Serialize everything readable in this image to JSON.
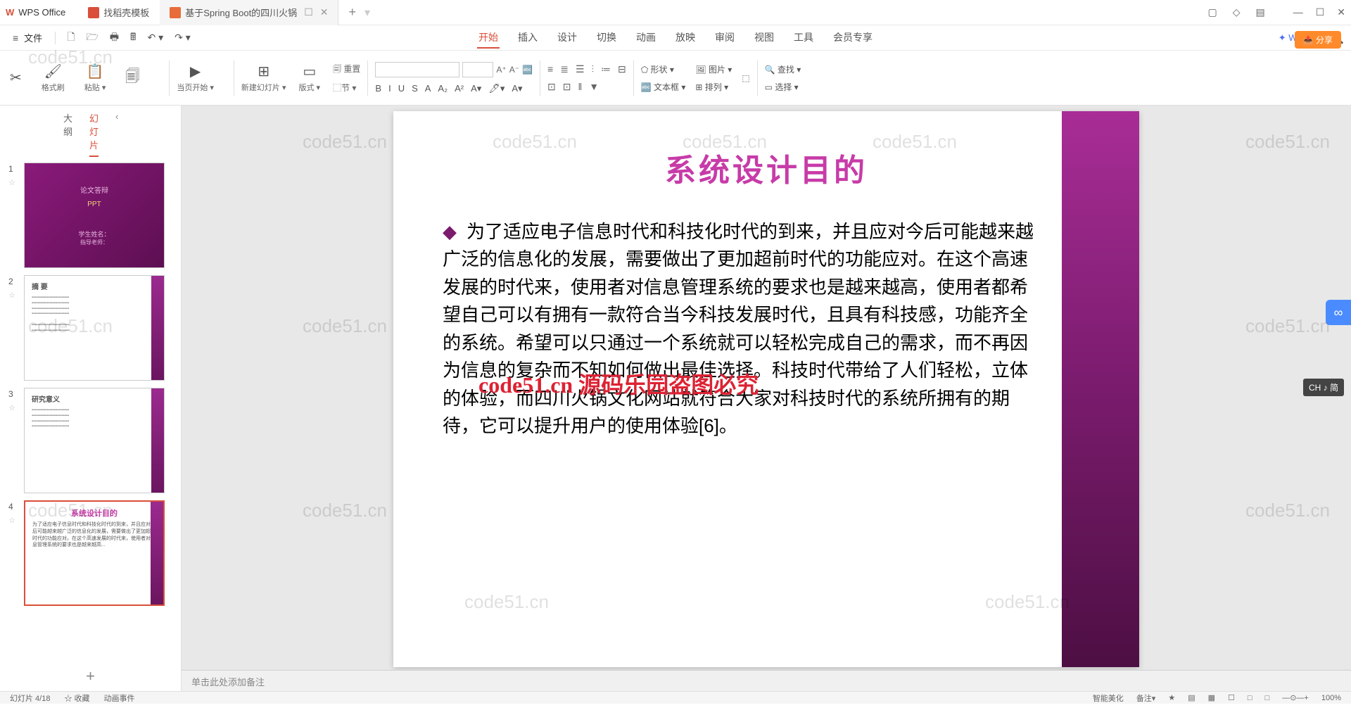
{
  "app": {
    "logo": "W",
    "name": "WPS Office"
  },
  "tabs": [
    {
      "icon_bg": "#d94f3a",
      "label": "找稻壳模板"
    },
    {
      "icon_bg": "#e86b3a",
      "label": "基于Spring Boot的四川火锅",
      "active": true
    }
  ],
  "win_icons": [
    "▢",
    "◇",
    "▤",
    "—",
    "☐",
    "✕"
  ],
  "qat": {
    "menu": "≡",
    "file": "文件",
    "icons": [
      "🗋",
      "🗁",
      "🖶",
      "🖩",
      "↶ ▾",
      "↷ ▾"
    ]
  },
  "ribbon": {
    "tabs": [
      "开始",
      "插入",
      "设计",
      "切换",
      "动画",
      "放映",
      "审阅",
      "视图",
      "工具",
      "会员专享"
    ],
    "active": 0,
    "ai": "WPS AI"
  },
  "tools": {
    "g1": [
      {
        "ico": "✂",
        "lbl": ""
      },
      {
        "ico": "🖌",
        "lbl": "格式刷"
      },
      {
        "ico": "📋",
        "lbl": "粘贴 ▾"
      },
      {
        "ico": "🗐",
        "lbl": ""
      }
    ],
    "g2": [
      {
        "ico": "▶",
        "lbl": "当页开始 ▾"
      }
    ],
    "g3": [
      {
        "ico": "⊞",
        "lbl": "新建幻灯片 ▾"
      },
      {
        "ico": "▭",
        "lbl": "版式 ▾"
      },
      {
        "ico": "🗐 重置",
        "lbl": "⬚节 ▾"
      }
    ],
    "font": [
      "B",
      "I",
      "U",
      "S",
      "A",
      "A₂",
      "A²",
      "A▾",
      "🖊▾",
      "A▾"
    ],
    "fsize": [
      "A⁺",
      "A⁻",
      "🔤"
    ],
    "para": [
      "≡",
      "≣",
      "☰",
      "⫶",
      "≔",
      "⊟",
      "⊡",
      "⊡",
      "‖",
      "▼"
    ],
    "g4": [
      {
        "ico": "⬠ 形状 ▾"
      },
      {
        "ico": "🔤 文本框 ▾"
      },
      {
        "ico": "⊞ 排列 ▾"
      }
    ],
    "g5": [
      {
        "ico": "🖼 图片 ▾"
      },
      {
        "ico": "⬚"
      }
    ],
    "g6": [
      {
        "ico": "🔍 查找 ▾"
      },
      {
        "ico": "▭ 选择 ▾"
      }
    ]
  },
  "sidebar": {
    "tabs": [
      "大纲",
      "幻灯片"
    ],
    "active": 1,
    "slides": [
      {
        "n": "1",
        "type": "title",
        "line1": "论文答辩",
        "line2": "学生姓名：",
        "line3": "指导老师："
      },
      {
        "n": "2",
        "type": "text",
        "title": "摘 要"
      },
      {
        "n": "3",
        "type": "text",
        "title": "研究意义"
      },
      {
        "n": "4",
        "type": "current",
        "title": "系统设计目的"
      }
    ]
  },
  "slide": {
    "title": "系统设计目的",
    "body": "为了适应电子信息时代和科技化时代的到来，并且应对今后可能越来越广泛的信息化的发展，需要做出了更加超前时代的功能应对。在这个高速发展的时代来，使用者对信息管理系统的要求也是越来越高，使用者都希望自己可以有拥有一款符合当今科技发展时代，且具有科技感，功能齐全的系统。希望可以只通过一个系统就可以轻松完成自己的需求，而不再因为信息的复杂而不知如何做出最佳选择。科技时代带给了人们轻松，立体的体验，而四川火锅文化网站就符合大家对科技时代的系统所拥有的期待，它可以提升用户的使用体验[6]。"
  },
  "notes": "单击此处添加备注",
  "share": "分享",
  "ime": "CH ♪ 简",
  "status": {
    "left": [
      "幻灯片 4/18",
      "☆ 收藏",
      "动画事件"
    ],
    "right": [
      "智能美化",
      "备注▾",
      "★",
      "▤",
      "▦",
      "☐",
      "□",
      "□",
      "—⊙—+",
      "100%"
    ]
  },
  "watermarks": {
    "text": "code51.cn",
    "red": "源码乐园盗图必究"
  }
}
